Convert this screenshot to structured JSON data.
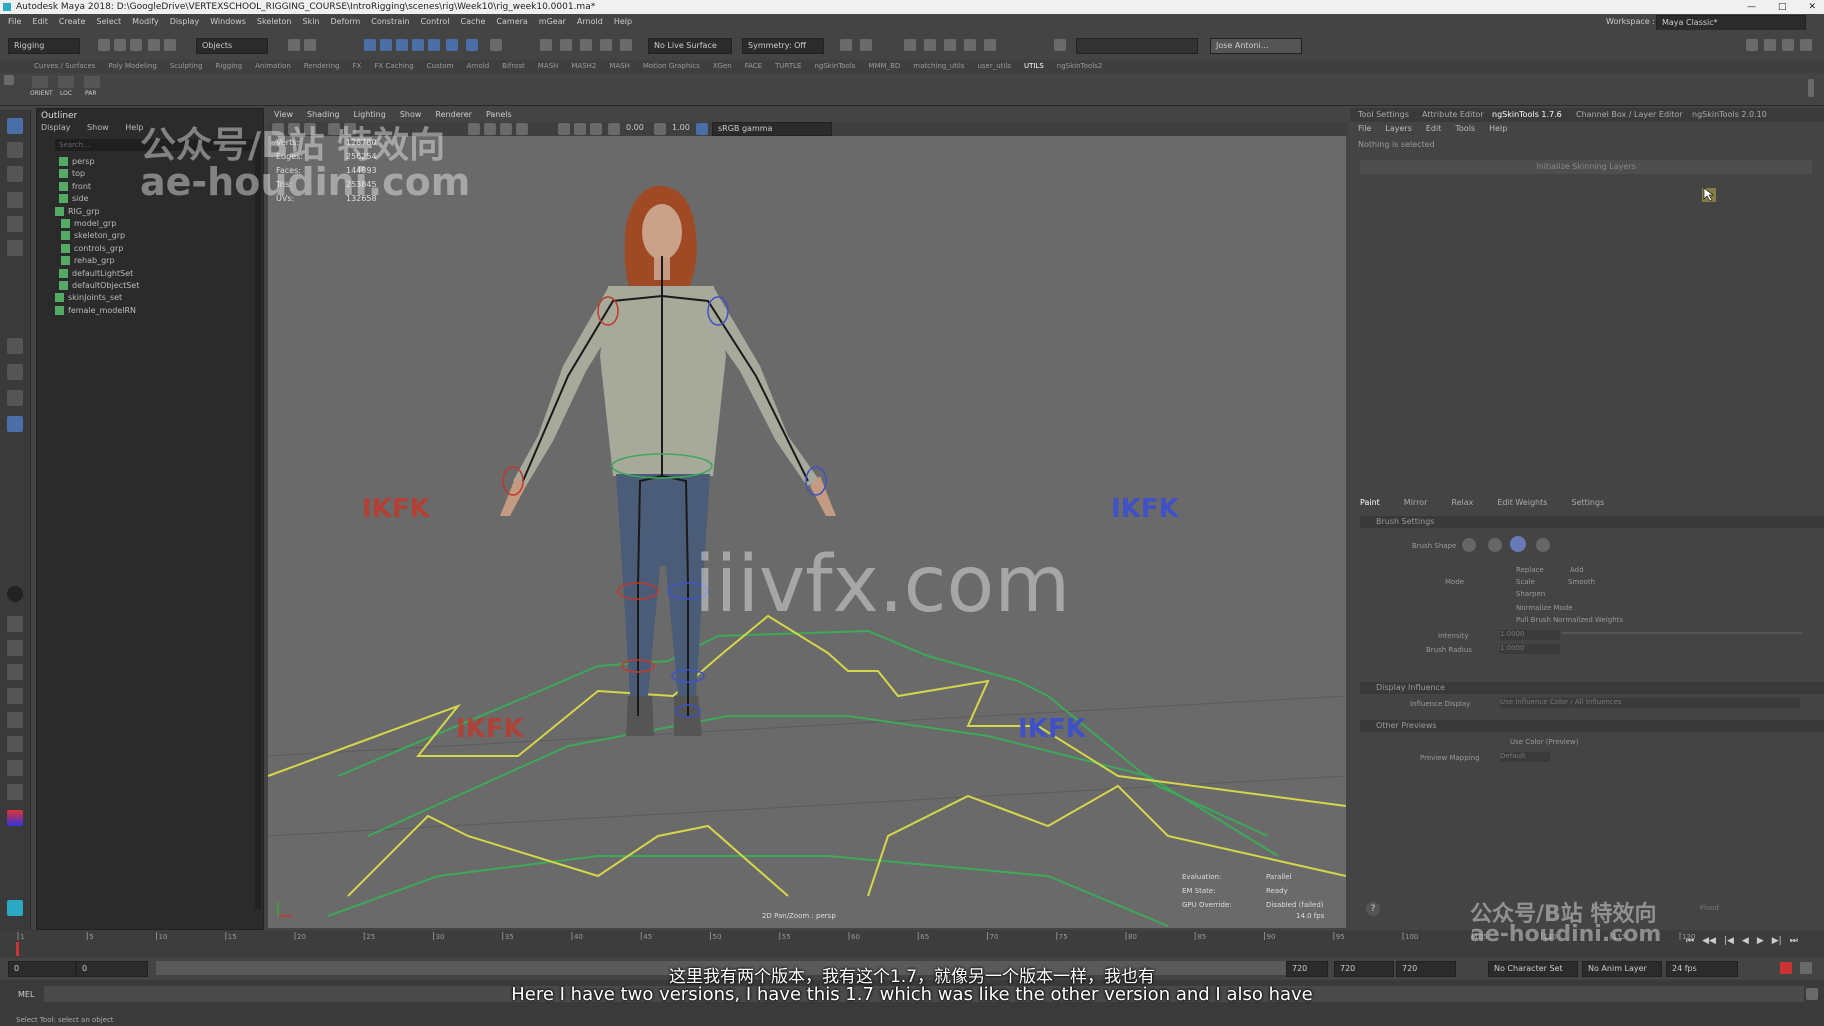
{
  "window": {
    "title": "Autodesk Maya 2018: D:\\GoogleDrive\\VERTEXSCHOOL_RIGGING_COURSE\\IntroRigging\\scenes\\rig\\Week10\\rig_week10.0001.ma*"
  },
  "menubar": [
    "File",
    "Edit",
    "Create",
    "Select",
    "Modify",
    "Display",
    "Windows",
    "Skeleton",
    "Skin",
    "Deform",
    "Constrain",
    "Control",
    "Cache",
    "Camera",
    "mGear",
    "Arnold",
    "Help"
  ],
  "workspace": {
    "label": "Workspace :",
    "value": "Maya Classic*"
  },
  "statusline": {
    "mode": "Rigging",
    "objects": "Objects",
    "live_surface": "No Live Surface",
    "symmetry": "Symmetry: Off",
    "user": "Jose Antoni..."
  },
  "shelf_tabs": [
    "Curves / Surfaces",
    "Poly Modeling",
    "Sculpting",
    "Rigging",
    "Animation",
    "Rendering",
    "FX",
    "FX Caching",
    "Custom",
    "Arnold",
    "Bifrost",
    "MASH",
    "MASH2",
    "MASH",
    "Motion Graphics",
    "XGen",
    "FACE",
    "TURTLE",
    "ngSkinTools",
    "MMM_BD",
    "matching_utils",
    "user_utils",
    "UTILS",
    "ngSkinTools2"
  ],
  "shelf_buttons": [
    "ORIENT",
    "LOC",
    "PAR"
  ],
  "outliner": {
    "title": "Outliner",
    "menu": [
      "Display",
      "Show",
      "Help"
    ],
    "search_placeholder": "Search...",
    "items": [
      "persp",
      "top",
      "front",
      "side",
      "RIG_grp",
      "model_grp",
      "skeleton_grp",
      "controls_grp",
      "rehab_grp",
      "defaultLightSet",
      "defaultObjectSet",
      "skinJoints_set",
      "female_modelRN"
    ]
  },
  "viewport": {
    "menu": [
      "View",
      "Shading",
      "Lighting",
      "Show",
      "Renderer",
      "Panels"
    ],
    "hud": [
      {
        "k": "Verts:",
        "v": "128780"
      },
      {
        "k": "Edges:",
        "v": "256254"
      },
      {
        "k": "Faces:",
        "v": "144893"
      },
      {
        "k": "Tris:",
        "v": "253845"
      },
      {
        "k": "UVs:",
        "v": "132658"
      }
    ],
    "exposure": "0.00",
    "gamma": "1.00",
    "colorspace": "sRGB gamma",
    "labels": [
      "IKFK",
      "IKFK",
      "IKFK",
      "IKFK"
    ],
    "camera": "2D Pan/Zoom : persp",
    "eval": [
      {
        "k": "Evaluation:",
        "v": "Parallel"
      },
      {
        "k": "EM State:",
        "v": "Ready"
      },
      {
        "k": "GPU Override:",
        "v": "Disabled (failed)"
      }
    ],
    "fps": "14.0 fps"
  },
  "right_panel": {
    "tabs": [
      "Tool Settings",
      "Attribute Editor",
      "ngSkinTools 1.7.6",
      "Channel Box / Layer Editor",
      "ngSkinTools 2.0.10"
    ],
    "menu": [
      "File",
      "Layers",
      "Edit",
      "Tools",
      "Help"
    ],
    "status": "Nothing is selected",
    "init_button": "Initialize Skinning Layers",
    "subtabs": [
      "Paint",
      "Mirror",
      "Relax",
      "Edit Weights",
      "Settings"
    ],
    "sections": [
      "Brush Settings",
      "Display Influence",
      "Other Previews"
    ],
    "brush_shape": "Brush Shape",
    "mode_label": "Mode",
    "modes": [
      "Replace",
      "Add",
      "Scale",
      "Smooth",
      "Sharpen"
    ],
    "checks": [
      "Normalize Mode",
      "Pull Brush Normalized Weights"
    ],
    "intensity_label": "Intensity",
    "intensity_value": "1.0000",
    "brush_radius_label": "Brush Radius",
    "brush_radius_value": "1.0000",
    "influence_label": "Influence Display",
    "influence_value": "Use Influence Color / All Influences",
    "use_color": "Use Color (Preview)",
    "preview_label": "Preview Mapping",
    "preview_value": "Default",
    "flood": "Flood"
  },
  "timeline": {
    "ticks": [
      "1",
      "5",
      "10",
      "15",
      "20",
      "25",
      "30",
      "35",
      "40",
      "45",
      "50",
      "55",
      "60",
      "65",
      "70",
      "75",
      "80",
      "85",
      "90",
      "95",
      "100",
      "105",
      "110",
      "115",
      "120"
    ]
  },
  "range": {
    "start": "0",
    "start2": "0",
    "end": "720",
    "end2": "720",
    "end3": "720",
    "char_set": "No Character Set",
    "anim_layer": "No Anim Layer",
    "fps": "24 fps"
  },
  "cmdline": {
    "label": "MEL"
  },
  "helpline": {
    "text": "Select Tool: select an object"
  },
  "watermarks": {
    "top1": "公众号/B站 特效向",
    "top2": "ae-houdini.com",
    "center": "iiivfx.com",
    "br1": "公众号/B站 特效向",
    "br2": "ae-houdini.com"
  },
  "subtitles": {
    "zh": "这里我有两个版本，我有这个1.7，就像另一个版本一样，我也有",
    "en": "Here I have two versions, I have this 1.7 which was like the other version and I also have"
  },
  "colors": {
    "viewport_bg": "#6a6a6a",
    "ikfk_red": "#c0392b",
    "ikfk_blue": "#3f51c7",
    "joint": "#222222",
    "ctrl_yellow": "#d6d64a",
    "ctrl_green": "#3ea85a"
  }
}
